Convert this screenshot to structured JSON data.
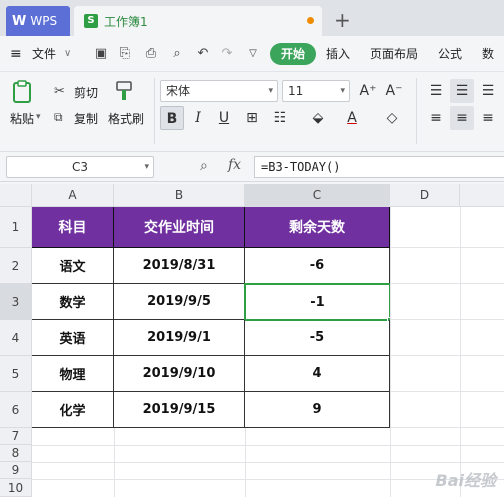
{
  "tabs": {
    "wps": "WPS",
    "doc": "工作簿1",
    "add": "+"
  },
  "menu": {
    "file": "文件",
    "start": "开始",
    "insert": "插入",
    "layout": "页面布局",
    "formula": "公式",
    "data": "数据"
  },
  "ribbon": {
    "paste": "粘贴",
    "cut": "剪切",
    "copy": "复制",
    "format_painter": "格式刷",
    "font_name": "宋体",
    "font_size": "11"
  },
  "formula_bar": {
    "cell_ref": "C3",
    "fx": "fx",
    "formula": "=B3-TODAY()"
  },
  "grid": {
    "columns": [
      "A",
      "B",
      "C",
      "D"
    ],
    "rows": [
      "1",
      "2",
      "3",
      "4",
      "5",
      "6",
      "7",
      "8",
      "9",
      "10"
    ],
    "header": [
      "科目",
      "交作业时间",
      "剩余天数"
    ],
    "data": [
      [
        "语文",
        "2019/8/31",
        "-6"
      ],
      [
        "数学",
        "2019/9/5",
        "-1"
      ],
      [
        "英语",
        "2019/9/1",
        "-5"
      ],
      [
        "物理",
        "2019/9/10",
        "4"
      ],
      [
        "化学",
        "2019/9/15",
        "9"
      ]
    ],
    "active_cell": "C3",
    "header_color": "#7030a0",
    "selection_color": "#2f9e44"
  },
  "watermark": "Bai经验"
}
